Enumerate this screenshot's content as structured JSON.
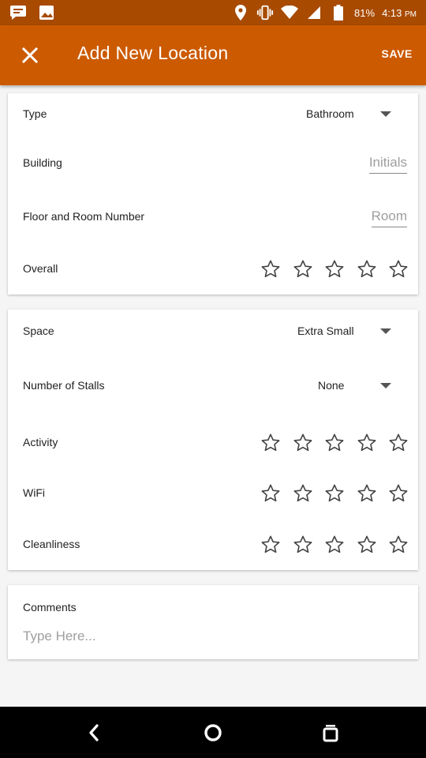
{
  "status_bar": {
    "left_icons": [
      "message-notification-icon",
      "image-notification-icon"
    ],
    "right_icons": [
      "location-icon",
      "vibrate-icon",
      "wifi-icon",
      "signal-icon",
      "battery-icon"
    ],
    "battery": "81%",
    "time": "4:13",
    "ampm": "PM"
  },
  "app_bar": {
    "title": "Add New Location",
    "save_label": "SAVE",
    "close_icon": "close-icon"
  },
  "card1": {
    "type_label": "Type",
    "type_value": "Bathroom",
    "building_label": "Building",
    "building_placeholder": "Initials",
    "floor_label": "Floor and Room Number",
    "floor_placeholder": "Room",
    "overall_label": "Overall",
    "overall_rating": 0
  },
  "card2": {
    "space_label": "Space",
    "space_value": "Extra Small",
    "stalls_label": "Number of Stalls",
    "stalls_value": "None",
    "activity_label": "Activity",
    "activity_rating": 0,
    "wifi_label": "WiFi",
    "wifi_rating": 0,
    "cleanliness_label": "Cleanliness",
    "cleanliness_rating": 0
  },
  "card3": {
    "comments_label": "Comments",
    "comments_placeholder": "Type Here..."
  },
  "nav_bar": {
    "buttons": [
      "back-icon",
      "home-icon",
      "recents-icon"
    ]
  },
  "colors": {
    "status_bar": "#a84a00",
    "app_bar": "#cc5a00",
    "star_outline": "#444444"
  }
}
